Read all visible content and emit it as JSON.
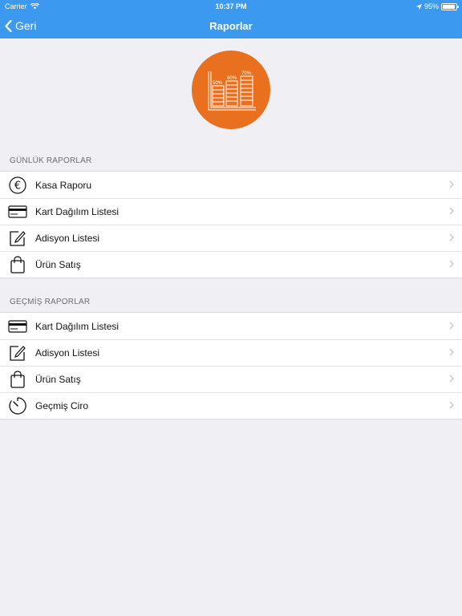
{
  "status": {
    "carrier": "Carrier",
    "time": "10:37 PM",
    "battery": "95%",
    "battery_level": 0.95
  },
  "nav": {
    "back_label": "Geri",
    "title": "Raporlar"
  },
  "logo": {
    "labels": [
      "50%",
      "60%",
      "70%"
    ]
  },
  "daily": {
    "header": "GÜNLÜK RAPORLAR",
    "items": [
      {
        "label": "Kasa Raporu",
        "icon": "euro-icon"
      },
      {
        "label": "Kart Dağılım Listesi",
        "icon": "credit-card-icon"
      },
      {
        "label": "Adisyon Listesi",
        "icon": "edit-icon"
      },
      {
        "label": "Ürün Satış",
        "icon": "shopping-bag-icon"
      }
    ]
  },
  "past": {
    "header": "GEÇMİŞ RAPORLAR",
    "items": [
      {
        "label": "Kart Dağılım Listesi",
        "icon": "credit-card-icon"
      },
      {
        "label": "Adisyon Listesi",
        "icon": "edit-icon"
      },
      {
        "label": "Ürün Satış",
        "icon": "shopping-bag-icon"
      },
      {
        "label": "Geçmiş Ciro",
        "icon": "timer-icon"
      }
    ]
  },
  "colors": {
    "accent": "#3b9af0",
    "logo": "#e8701e",
    "background": "#efeff4"
  }
}
